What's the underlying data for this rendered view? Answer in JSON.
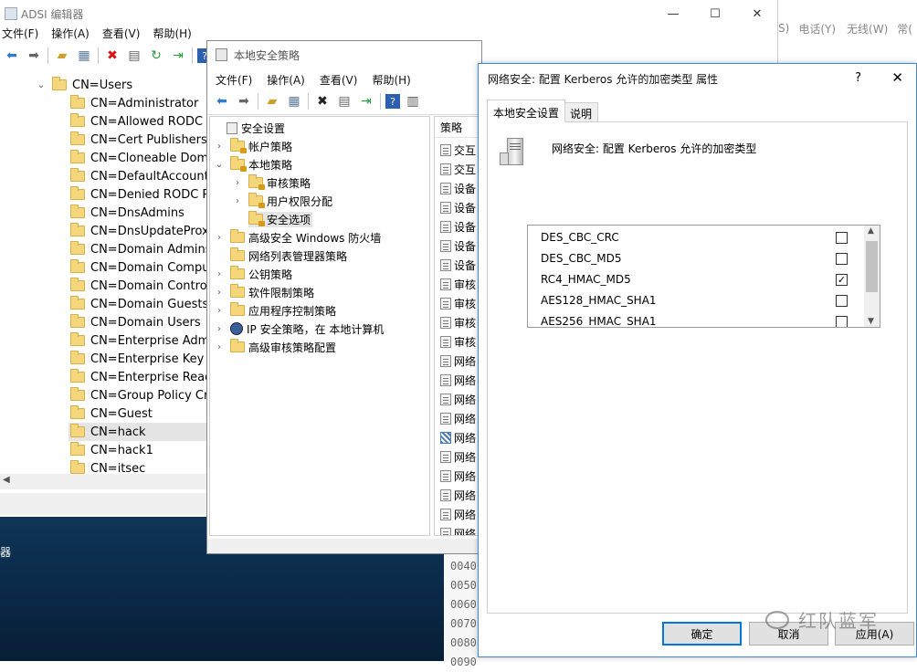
{
  "adsi": {
    "title": "ADSI 编辑器",
    "menu": [
      "文件(F)",
      "操作(A)",
      "查看(V)",
      "帮助(H)"
    ],
    "root": "CN=Users",
    "items": [
      "CN=Administrator",
      "CN=Allowed RODC Pa",
      "CN=Cert Publishers",
      "CN=Cloneable Domai",
      "CN=DefaultAccount",
      "CN=Denied RODC Pas",
      "CN=DnsAdmins",
      "CN=DnsUpdateProxy",
      "CN=Domain Admins",
      "CN=Domain Compute",
      "CN=Domain Controlle",
      "CN=Domain Guests",
      "CN=Domain Users",
      "CN=Enterprise Admin",
      "CN=Enterprise Key Ac",
      "CN=Enterprise Read-c",
      "CN=Group Policy Crea",
      "CN=Guest",
      "CN=hack",
      "CN=hack1",
      "CN=itsec"
    ],
    "selected_index": 18
  },
  "bg_menu_right": [
    "S)",
    "电话(Y)",
    "无线(W)",
    "常("
  ],
  "bg_taskbar_text": "器",
  "hex_rows": [
    "0090",
    "0040",
    "0050",
    "0060",
    "0070",
    "0080",
    "0090"
  ],
  "secpol": {
    "title": "本地安全策略",
    "menu": [
      "文件(F)",
      "操作(A)",
      "查看(V)",
      "帮助(H)"
    ],
    "tree": [
      {
        "label": "安全设置",
        "level": 0,
        "chev": "",
        "icon": "settings"
      },
      {
        "label": "帐户策略",
        "level": 1,
        "chev": "›",
        "icon": "lockfolder"
      },
      {
        "label": "本地策略",
        "level": 1,
        "chev": "⌄",
        "icon": "lockfolder"
      },
      {
        "label": "审核策略",
        "level": 2,
        "chev": "›",
        "icon": "lockfolder"
      },
      {
        "label": "用户权限分配",
        "level": 2,
        "chev": "›",
        "icon": "lockfolder"
      },
      {
        "label": "安全选项",
        "level": 2,
        "chev": "",
        "icon": "lockfolder"
      },
      {
        "label": "高级安全 Windows 防火墙",
        "level": 1,
        "chev": "›",
        "icon": "folder"
      },
      {
        "label": "网络列表管理器策略",
        "level": 1,
        "chev": "",
        "icon": "folder"
      },
      {
        "label": "公钥策略",
        "level": 1,
        "chev": "›",
        "icon": "folder"
      },
      {
        "label": "软件限制策略",
        "level": 1,
        "chev": "›",
        "icon": "folder"
      },
      {
        "label": "应用程序控制策略",
        "level": 1,
        "chev": "›",
        "icon": "folder"
      },
      {
        "label": "IP 安全策略，在 本地计算机",
        "level": 1,
        "chev": "›",
        "icon": "ipsec"
      },
      {
        "label": "高级审核策略配置",
        "level": 1,
        "chev": "›",
        "icon": "folder"
      }
    ],
    "selected_tree_index": 5,
    "list_header": "策略",
    "list_items": [
      "交互",
      "交互",
      "设备",
      "设备",
      "设备",
      "设备",
      "设备",
      "审核",
      "审核",
      "审核",
      "审核",
      "网络",
      "网络",
      "网络",
      "网络",
      "网络",
      "网络",
      "网络",
      "网络",
      "网络",
      "网络"
    ],
    "list_highlight_index": 15
  },
  "props": {
    "title": "网络安全: 配置 Kerberos 允许的加密类型 属性",
    "help_glyph": "?",
    "tabs": [
      "本地安全设置",
      "说明"
    ],
    "active_tab": 0,
    "policy_name": "网络安全: 配置 Kerberos 允许的加密类型",
    "options": [
      {
        "label": "DES_CBC_CRC",
        "checked": false
      },
      {
        "label": "DES_CBC_MD5",
        "checked": false
      },
      {
        "label": "RC4_HMAC_MD5",
        "checked": true
      },
      {
        "label": "AES128_HMAC_SHA1",
        "checked": false
      },
      {
        "label": "AES256_HMAC_SHA1",
        "checked": false
      }
    ],
    "ok_label": "确定",
    "cancel_label": "取消",
    "apply_label": "应用(A)"
  },
  "watermark": "红队蓝军",
  "colors": {
    "accent": "#0078d7",
    "desktop": "#0b2a4a"
  }
}
